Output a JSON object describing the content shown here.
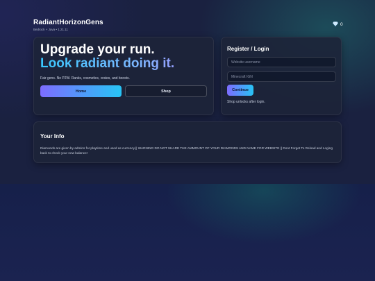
{
  "header": {
    "brand_name": "RadiantHorizonGens",
    "brand_sub": "Bedrock + Java • 1.21.11",
    "gem_icon": "diamond-icon",
    "gem_count": "0"
  },
  "hero": {
    "line1": "Upgrade your run.",
    "line2": "Look radiant doing it.",
    "tagline": "Fair gens. No P2W. Ranks, cosmetics, crates, and boosts.",
    "home_label": "Home",
    "shop_label": "Shop"
  },
  "login": {
    "title": "Register / Login",
    "username_placeholder": "Website username",
    "ign_placeholder": "Minecraft IGN",
    "continue_label": "Continue",
    "hint": "Shop unlocks after login."
  },
  "info": {
    "title": "Your Info",
    "text": "Diamonds are given by admins for playtime and used as currency.|| WARNING DO NOT SHARE THE AMMOUNT OF YOUR DIAMONDS AND NAME FOR WEBSITE || Dont Forget To Reload and Loging back to check your new balance!"
  },
  "colors": {
    "accent_start": "#7d6cff",
    "accent_end": "#27c4f5",
    "background": "#1a2140"
  }
}
